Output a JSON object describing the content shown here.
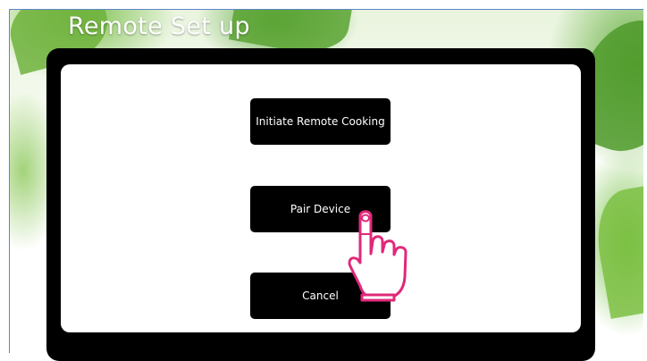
{
  "screen": {
    "title": "Remote Set up"
  },
  "menu": {
    "buttons": [
      {
        "label": "Initiate Remote Cooking"
      },
      {
        "label": "Pair Device"
      },
      {
        "label": "Cancel"
      }
    ]
  },
  "icons": {
    "pointer": "pointing-hand-icon"
  },
  "colors": {
    "button_bg": "#000000",
    "button_text": "#ffffff",
    "hand_outline": "#e0287a",
    "accent_green": "#6fb23c"
  }
}
